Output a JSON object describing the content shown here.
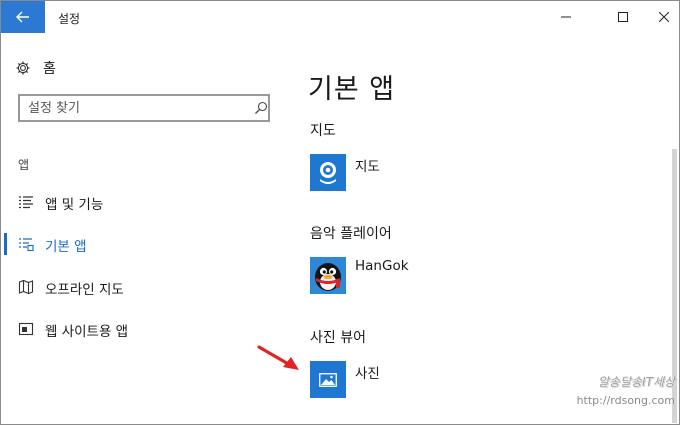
{
  "window": {
    "title": "설정"
  },
  "sidebar": {
    "home_label": "홈",
    "search": {
      "placeholder": "설정 찾기"
    },
    "group_label": "앱",
    "items": [
      {
        "label": "앱 및 기능",
        "icon": "list-icon",
        "active": false
      },
      {
        "label": "기본 앱",
        "icon": "default-apps-icon",
        "active": true
      },
      {
        "label": "오프라인 지도",
        "icon": "map-icon",
        "active": false
      },
      {
        "label": "웹 사이트용 앱",
        "icon": "web-app-icon",
        "active": false
      }
    ]
  },
  "main": {
    "title": "기본 앱",
    "sections": [
      {
        "heading": "지도",
        "app_name": "지도",
        "tile_icon": "maps-camera-icon"
      },
      {
        "heading": "음악 플레이어",
        "app_name": "HanGok",
        "tile_icon": "hangok-penguin-icon"
      },
      {
        "heading": "사진 뷰어",
        "app_name": "사진",
        "tile_icon": "photos-icon"
      }
    ]
  },
  "watermark": {
    "line1": "알송달송IT세상",
    "line2": "http://rdsong.com"
  },
  "colors": {
    "accent": "#1b6ac9",
    "tile": "#1e78d2",
    "arrow": "#e02424"
  }
}
